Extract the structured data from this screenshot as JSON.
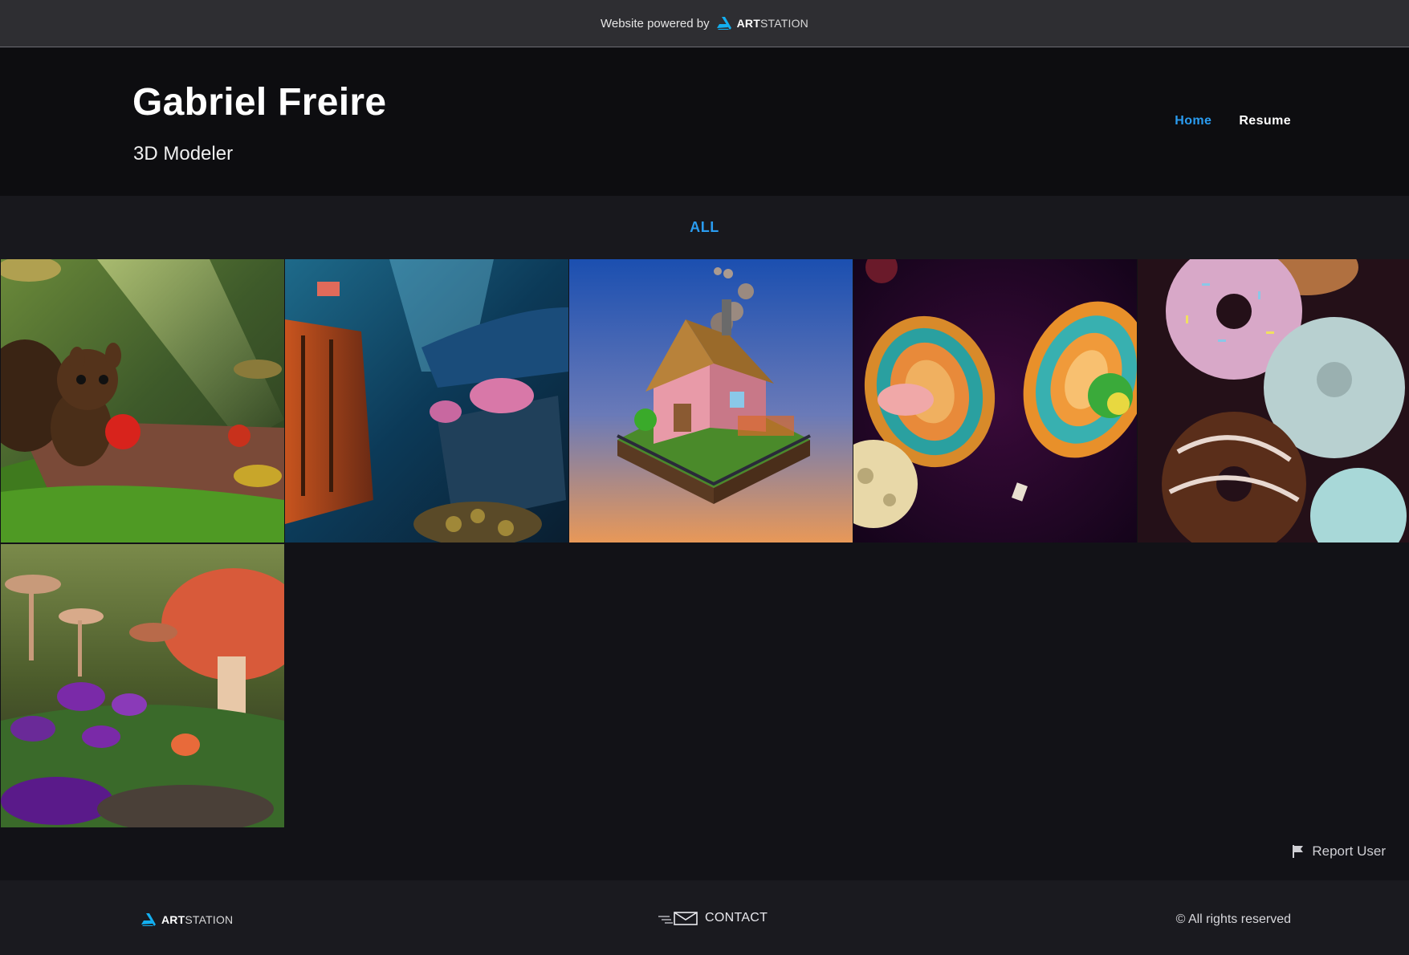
{
  "powered_bar": {
    "text": "Website powered by",
    "brand_strong": "ART",
    "brand_light": "STATION"
  },
  "header": {
    "title": "Gabriel Freire",
    "subtitle": "3D Modeler",
    "nav": [
      {
        "label": "Home",
        "active": true
      },
      {
        "label": "Resume",
        "active": false
      }
    ]
  },
  "filter": {
    "label": "ALL"
  },
  "gallery": {
    "items": [
      {
        "subject": "squirrel with apple"
      },
      {
        "subject": "blue underwater treasure room"
      },
      {
        "subject": "isometric cottage"
      },
      {
        "subject": "space rings and planets"
      },
      {
        "subject": "sprinkled donuts"
      },
      {
        "subject": "mushroom forest"
      }
    ]
  },
  "report": {
    "label": "Report User",
    "icon": "flag-icon"
  },
  "footer": {
    "brand_strong": "ART",
    "brand_light": "STATION",
    "contact_label": "CONTACT",
    "contact_icon": "mail-icon",
    "copyright": "© All rights reserved"
  },
  "colors": {
    "accent": "#2a9cf0",
    "background": "#121217",
    "header_bg": "#0d0d10",
    "top_bar": "#2e2e32"
  }
}
